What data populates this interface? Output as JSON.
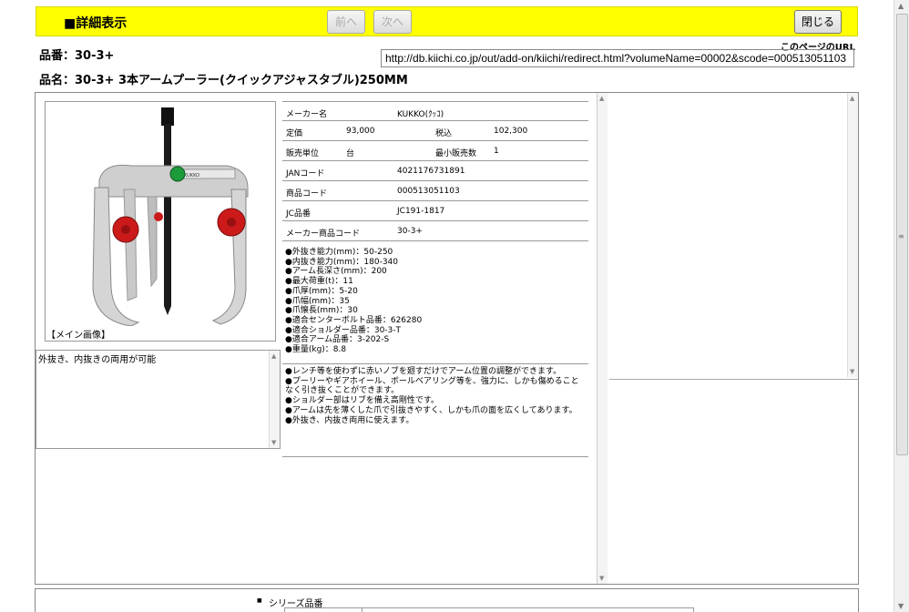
{
  "header": {
    "title": "■詳細表示",
    "prev_label": "前へ",
    "next_label": "次へ",
    "close_label": "閉じる"
  },
  "product": {
    "hinban": "品番：30-3+",
    "hinmei": "品名：30-3+ 3本アームプーラー(クイックアジャスタブル)250MM"
  },
  "url": {
    "label": "このページのURL",
    "value": "http://db.kiichi.co.jp/out/add-on/kiichi/redirect.html?volumeName=00002&scode=000513051103"
  },
  "image": {
    "caption": "【メイン画像】",
    "brand_text": "KUKKO"
  },
  "description": "外抜き、内抜きの両用が可能",
  "spec_table": {
    "maker_label": "メーカー名",
    "maker_value": "KUKKO(ｸｯｺ)",
    "price_label": "定価",
    "price_value": "93,000",
    "tax_label": "税込",
    "tax_value": "102,300",
    "unit_label": "販売単位",
    "unit_value": "台",
    "min_label": "最小販売数",
    "min_value": "1",
    "jan_label": "JANコード",
    "jan_value": "4021176731891",
    "code_label": "商品コード",
    "code_value": "000513051103",
    "jc_label": "JC品番",
    "jc_value": "JC191-1817",
    "maker_code_label": "メーカー商品コード",
    "maker_code_value": "30-3+"
  },
  "spec_list": [
    "●外抜き能力(mm)：50-250",
    "●内抜き能力(mm)：180-340",
    "●アーム長深さ(mm)：200",
    "●最大荷重(t)：11",
    "●爪厚(mm)：5-20",
    "●爪幅(mm)：35",
    "●爪懐長(mm)：30",
    "●適合センターボルト品番：626280",
    "●適合ショルダー品番：30-3-T",
    "●適合アーム品番：3-202-S",
    "●重量(kg)：8.8"
  ],
  "feature_list": [
    "●レンチ等を使わずに赤いノブを廻すだけでアーム位置の調整ができます。",
    "●プーリーやギアホイール、ボールベアリング等を、強力に、しかも傷めることなく引き抜くことができます。",
    "●ショルダー部はリブを備え高剛性です。",
    "●アームは先を薄くした爪で引抜きやすく、しかも爪の面を広くしてあります。",
    "●外抜き、内抜き両用に使えます。"
  ],
  "bottom": {
    "series_label": "シリーズ品番"
  },
  "colors": {
    "header_bg": "#ffff00",
    "knob_red": "#cc1a1a",
    "green_badge": "#1d9a3a"
  }
}
